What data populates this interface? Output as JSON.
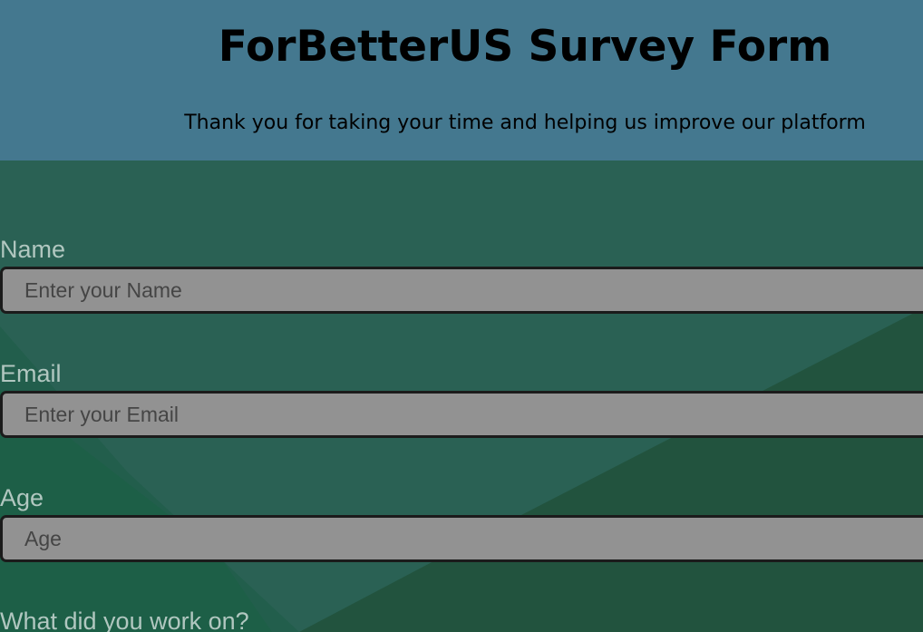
{
  "header": {
    "title": "ForBetterUS Survey Form",
    "subtitle": "Thank you for taking your time and helping us improve our platform"
  },
  "form": {
    "name": {
      "label": "Name",
      "placeholder": "Enter your Name"
    },
    "email": {
      "label": "Email",
      "placeholder": "Enter your Email"
    },
    "age": {
      "label": "Age",
      "placeholder": "Age"
    },
    "work": {
      "label": "What did you work on?"
    }
  },
  "colors": {
    "header_bg": "#44788f",
    "page_bg": "#2a6154",
    "label_text": "#b1c7c0",
    "input_bg": "#929292",
    "input_border": "#1b1b1b"
  }
}
